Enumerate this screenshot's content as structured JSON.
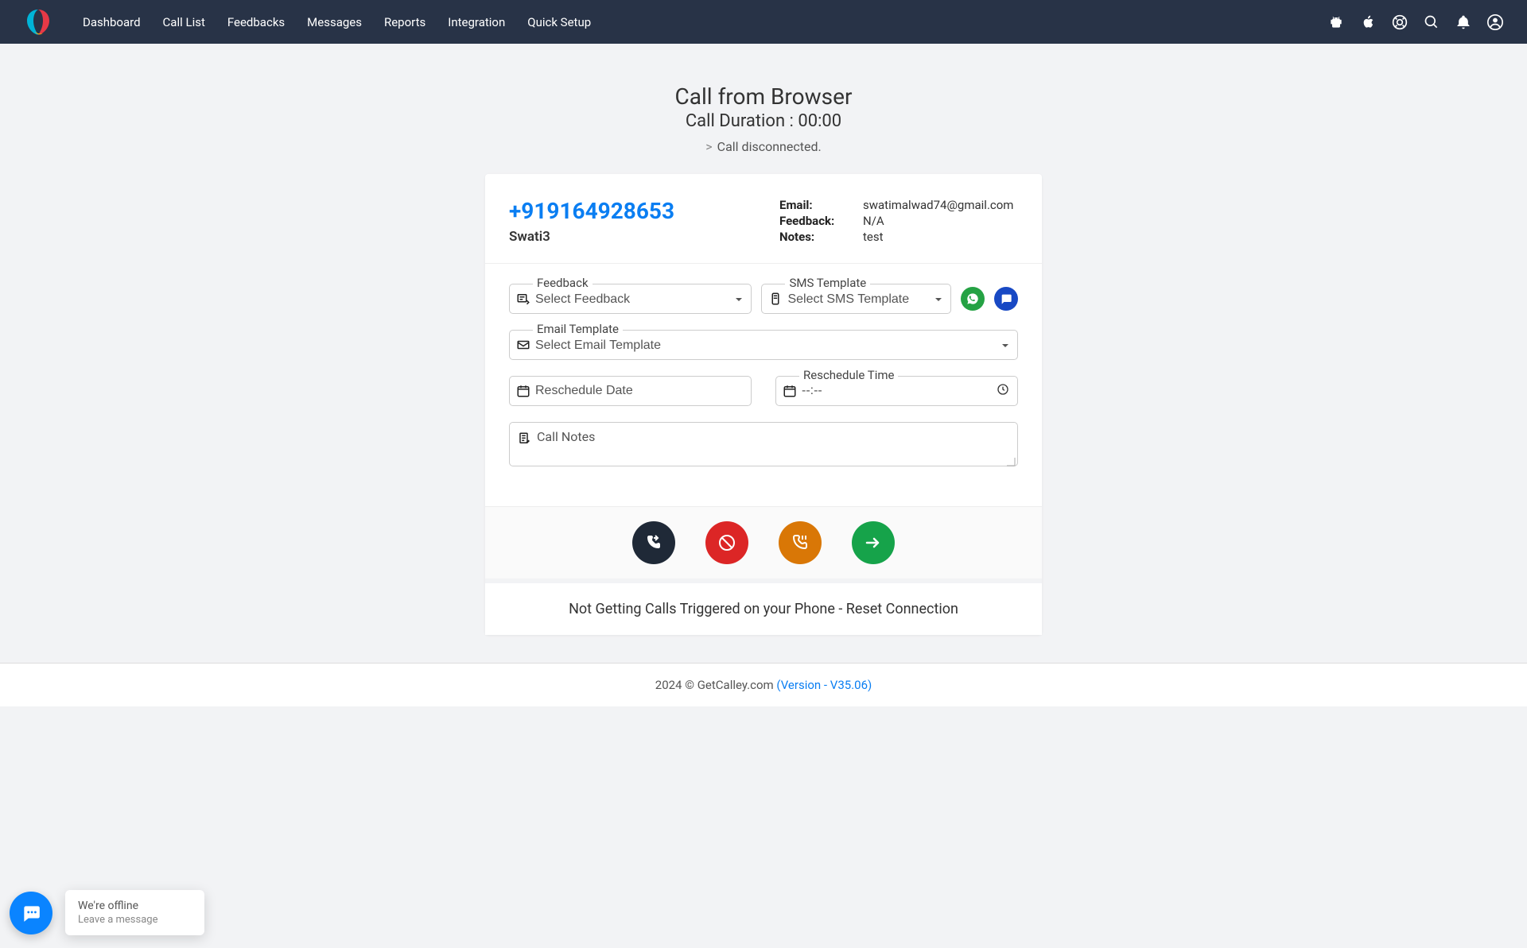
{
  "nav": {
    "items": [
      "Dashboard",
      "Call List",
      "Feedbacks",
      "Messages",
      "Reports",
      "Integration",
      "Quick Setup"
    ]
  },
  "header": {
    "title": "Call from Browser",
    "subtitle": "Call Duration : 00:00",
    "status": "Call disconnected."
  },
  "contact": {
    "phone": "+919164928653",
    "name": "Swati3",
    "email_label": "Email:",
    "email": "swatimalwad74@gmail.com",
    "feedback_label": "Feedback:",
    "feedback": "N/A",
    "notes_label": "Notes:",
    "notes": "test"
  },
  "form": {
    "feedback_label": "Feedback",
    "feedback_placeholder": "Select Feedback",
    "sms_label": "SMS Template",
    "sms_placeholder": "Select SMS Template",
    "email_label": "Email Template",
    "email_placeholder": "Select Email Template",
    "reschedule_date_placeholder": "Reschedule Date",
    "reschedule_time_label": "Reschedule Time",
    "reschedule_time_placeholder": "--:--",
    "call_notes_placeholder": "Call Notes"
  },
  "reset": {
    "text": "Not Getting Calls Triggered on your Phone - Reset Connection"
  },
  "footer": {
    "copyright": "2024 © GetCalley.com ",
    "version": "(Version - V35.06)"
  },
  "chat": {
    "title": "We're offline",
    "sub": "Leave a message"
  }
}
